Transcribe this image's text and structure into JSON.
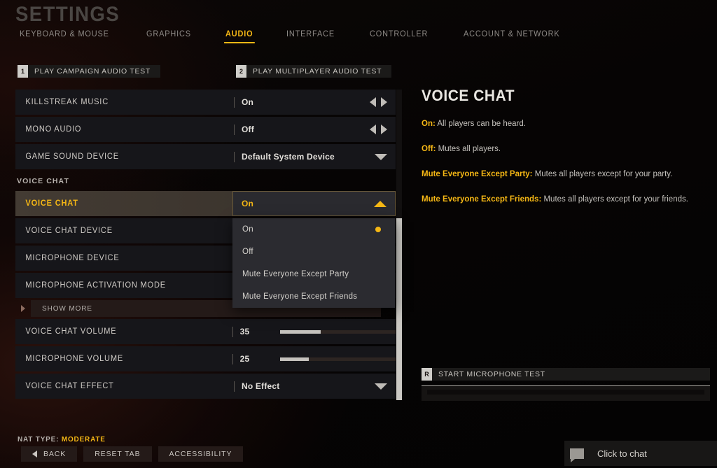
{
  "header": {
    "title": "SETTINGS",
    "tabs": [
      {
        "label": "KEYBOARD & MOUSE",
        "active": false
      },
      {
        "label": "GRAPHICS",
        "active": false
      },
      {
        "label": "AUDIO",
        "active": true
      },
      {
        "label": "INTERFACE",
        "active": false
      },
      {
        "label": "CONTROLLER",
        "active": false
      },
      {
        "label": "ACCOUNT & NETWORK",
        "active": false
      }
    ],
    "accent_color": "#f5b715"
  },
  "audio_tests": [
    {
      "key": "1",
      "label": "PLAY CAMPAIGN AUDIO TEST"
    },
    {
      "key": "2",
      "label": "PLAY MULTIPLAYER AUDIO TEST"
    }
  ],
  "settings": {
    "rows": [
      {
        "label": "KILLSTREAK MUSIC",
        "value": "On",
        "control": "arrows"
      },
      {
        "label": "MONO AUDIO",
        "value": "Off",
        "control": "arrows"
      },
      {
        "label": "GAME SOUND DEVICE",
        "value": "Default System Device",
        "control": "dropdown"
      }
    ],
    "section_label": "VOICE CHAT",
    "voice_rows": [
      {
        "label": "VOICE CHAT",
        "value": "On",
        "control": "dropdown-open",
        "selected": true
      },
      {
        "label": "VOICE CHAT DEVICE",
        "value": "",
        "control": "none"
      },
      {
        "label": "MICROPHONE DEVICE",
        "value": "",
        "control": "none"
      },
      {
        "label": "MICROPHONE ACTIVATION MODE",
        "value": "",
        "control": "none"
      }
    ],
    "show_more_label": "SHOW MORE",
    "slider_rows": [
      {
        "label": "VOICE CHAT VOLUME",
        "value": "35",
        "fill_percent": 35
      },
      {
        "label": "MICROPHONE VOLUME",
        "value": "25",
        "fill_percent": 25
      }
    ],
    "effect_row": {
      "label": "VOICE CHAT EFFECT",
      "value": "No Effect",
      "control": "dropdown"
    }
  },
  "dropdown": {
    "options": [
      {
        "label": "On",
        "selected": true
      },
      {
        "label": "Off",
        "selected": false
      },
      {
        "label": "Mute Everyone Except Party",
        "selected": false
      },
      {
        "label": "Mute Everyone Except Friends",
        "selected": false
      }
    ]
  },
  "info_panel": {
    "title": "VOICE CHAT",
    "lines": [
      {
        "term": "On:",
        "desc": " All players can be heard."
      },
      {
        "term": "Off:",
        "desc": " Mutes all players."
      },
      {
        "term": "Mute Everyone Except Party:",
        "desc": " Mutes all players except for your party."
      },
      {
        "term": "Mute Everyone Except Friends:",
        "desc": " Mutes all players except for your friends."
      }
    ]
  },
  "mic_test": {
    "key": "R",
    "label": "START MICROPHONE TEST"
  },
  "footer": {
    "nat_label": "NAT TYPE:",
    "nat_value": "MODERATE",
    "buttons": [
      {
        "label": "BACK",
        "has_back_arrow": true
      },
      {
        "label": "RESET TAB",
        "has_back_arrow": false
      },
      {
        "label": "ACCESSIBILITY",
        "has_back_arrow": false
      }
    ],
    "chat_label": "Click to chat"
  }
}
